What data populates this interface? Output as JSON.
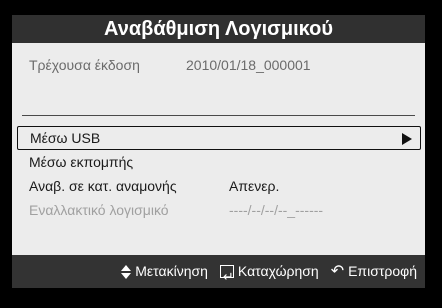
{
  "title": "Αναβάθμιση Λογισμικού",
  "info": {
    "current_version_label": "Τρέχουσα έκδοση",
    "current_version_value": "2010/01/18_000001"
  },
  "menu": {
    "items": [
      {
        "label": "Μέσω USB",
        "value": "",
        "selected": true
      },
      {
        "label": "Μέσω εκπομπής",
        "value": ""
      },
      {
        "label": "Αναβ. σε κατ. αναμονής",
        "value": "Απενερ."
      },
      {
        "label": "Εναλλακτικό λογισμικό",
        "value": "----/--/--/--_------"
      }
    ]
  },
  "footer": {
    "move_label": "Μετακίνηση",
    "enter_label": "Καταχώρηση",
    "return_label": "Επιστροφή",
    "return_icon": "↶"
  },
  "colors": {
    "title_bg": "#303030",
    "content_bg": "#ececec",
    "footer_bg": "#333333",
    "disabled_text": "#a0a0a0"
  }
}
